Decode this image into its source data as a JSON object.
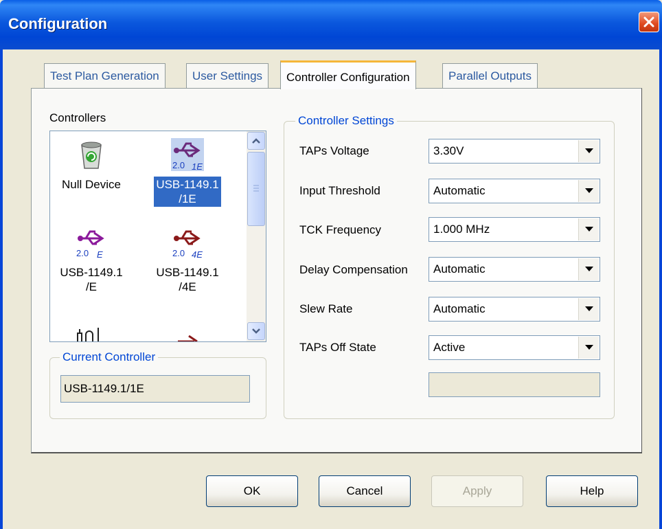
{
  "window": {
    "title": "Configuration"
  },
  "tabs": [
    {
      "label": "Test Plan Generation",
      "active": false
    },
    {
      "label": "User Settings",
      "active": false
    },
    {
      "label": "Controller Configuration",
      "active": true
    },
    {
      "label": "Parallel Outputs",
      "active": false
    }
  ],
  "controllers": {
    "label": "Controllers",
    "items": [
      {
        "name": "Null Device",
        "icon": "recycle-bin-icon",
        "selected": false
      },
      {
        "name": "USB-1149.1\n/1E",
        "icon": "usb-1e-icon",
        "badge": "2.0 1E",
        "color": "#6b2a7b",
        "selected": true
      },
      {
        "name": "USB-1149.1\n/E",
        "icon": "usb-e-icon",
        "badge": "2.0 E",
        "color": "#8b1a9b",
        "selected": false
      },
      {
        "name": "USB-1149.1\n/4E",
        "icon": "usb-4e-icon",
        "badge": "2.0 4E",
        "color": "#8b1a1a",
        "selected": false
      }
    ]
  },
  "current_controller": {
    "label": "Current Controller",
    "value": "USB-1149.1/1E"
  },
  "settings": {
    "label": "Controller Settings",
    "rows": [
      {
        "label": "TAPs Voltage",
        "value": "3.30V"
      },
      {
        "label": "Input Threshold",
        "value": "Automatic"
      },
      {
        "label": "TCK Frequency",
        "value": "1.000 MHz"
      },
      {
        "label": "Delay Compensation",
        "value": "Automatic"
      },
      {
        "label": "Slew Rate",
        "value": "Automatic"
      },
      {
        "label": "TAPs Off State",
        "value": "Active"
      }
    ],
    "extra_field": ""
  },
  "buttons": {
    "ok": "OK",
    "cancel": "Cancel",
    "apply": "Apply",
    "help": "Help"
  }
}
